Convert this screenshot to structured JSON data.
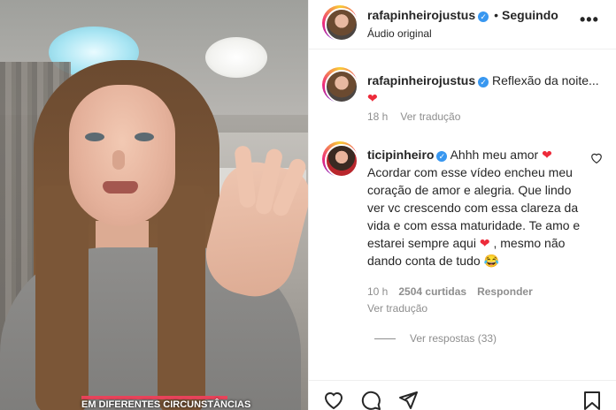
{
  "video": {
    "caption": "EM DIFERENTES CIRCUNSTÂNCIAS"
  },
  "header": {
    "username": "rafapinheirojustus",
    "separator": "•",
    "follow_status": "Seguindo",
    "audio": "Áudio original",
    "more_label": "•••"
  },
  "caption": {
    "username": "rafapinheirojustus",
    "text": "Reflexão da noite...",
    "emoji": "❤",
    "time": "18 h",
    "translate": "Ver tradução"
  },
  "comment": {
    "username": "ticipinheiro",
    "line_start": "Ahhh meu amor",
    "emoji1": "❤",
    "text_mid": "Acordar com esse vídeo encheu meu coração de amor e alegria. Que lindo ver vc crescendo com essa clareza da vida e com essa maturidade. Te amo e estarei sempre aqui",
    "emoji2": "❤",
    "text_end": ", mesmo não dando conta de tudo",
    "emoji3": "😂",
    "time": "10 h",
    "likes": "2504 curtidas",
    "reply": "Responder",
    "translate": "Ver tradução",
    "view_replies": "Ver respostas (33)"
  },
  "icons": {
    "verified": "verified-badge-icon",
    "like": "heart-icon",
    "comment": "comment-icon",
    "share": "send-icon",
    "save": "bookmark-icon"
  },
  "colors": {
    "verified": "#3897f0",
    "heart": "#ed2b3a",
    "muted": "#8e8e8e",
    "text": "#262626"
  }
}
